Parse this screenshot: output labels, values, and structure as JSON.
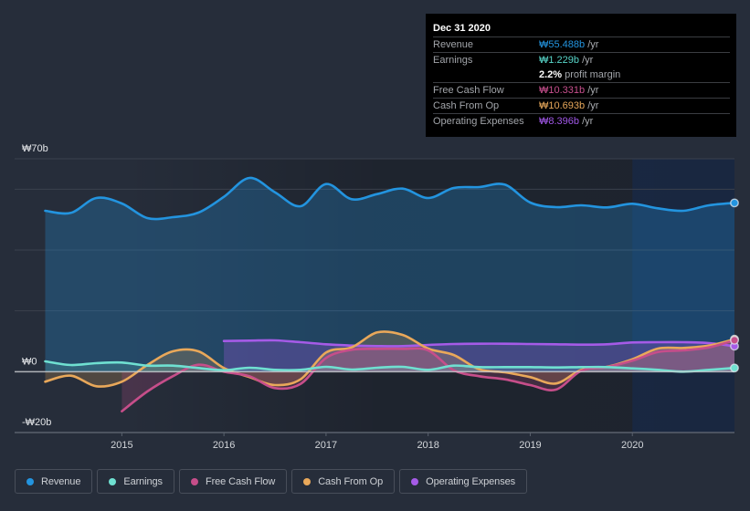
{
  "tooltip": {
    "date": "Dec 31 2020",
    "rows": [
      {
        "label": "Revenue",
        "value": "₩55.488b",
        "unit": " /yr",
        "color": "#2394df"
      },
      {
        "label": "Earnings",
        "value": "₩1.229b",
        "unit": " /yr",
        "color": "#58d5c9"
      },
      {
        "label": "Free Cash Flow",
        "value": "₩10.331b",
        "unit": " /yr",
        "color": "#c9508f"
      },
      {
        "label": "Cash From Op",
        "value": "₩10.693b",
        "unit": " /yr",
        "color": "#e6a75a"
      },
      {
        "label": "Operating Expenses",
        "value": "₩8.396b",
        "unit": " /yr",
        "color": "#a158e8"
      }
    ],
    "profit_margin": {
      "value": "2.2%",
      "text": " profit margin"
    }
  },
  "legend": [
    {
      "label": "Revenue",
      "color": "#2394df",
      "icon": "dot-icon"
    },
    {
      "label": "Earnings",
      "color": "#6fe0d1",
      "icon": "dot-icon"
    },
    {
      "label": "Free Cash Flow",
      "color": "#c64e8a",
      "icon": "dot-icon"
    },
    {
      "label": "Cash From Op",
      "color": "#e9a85a",
      "icon": "dot-icon"
    },
    {
      "label": "Operating Expenses",
      "color": "#a55be7",
      "icon": "dot-icon"
    }
  ],
  "chart_data": {
    "type": "line",
    "title": "",
    "xlabel": "",
    "ylabel": "",
    "xlim": [
      2013.95,
      2021.0
    ],
    "ylim": [
      -20,
      70
    ],
    "grid": true,
    "gridlines": [
      70,
      60,
      40,
      20
    ],
    "zero_line": 0,
    "highlight_range": [
      2020.0,
      2021.0
    ],
    "legend_position": "bottom-left",
    "y_ticks": [
      {
        "value": 70,
        "label": "₩70b"
      },
      {
        "value": 0,
        "label": "₩0"
      },
      {
        "value": -20,
        "label": "-₩20b"
      }
    ],
    "x_ticks": [
      {
        "value": 2015,
        "label": "2015"
      },
      {
        "value": 2016,
        "label": "2016"
      },
      {
        "value": 2017,
        "label": "2017"
      },
      {
        "value": 2018,
        "label": "2018"
      },
      {
        "value": 2019,
        "label": "2019"
      },
      {
        "value": 2020,
        "label": "2020"
      }
    ],
    "x": [
      2014.25,
      2014.5,
      2014.75,
      2015.0,
      2015.25,
      2015.5,
      2015.75,
      2016.0,
      2016.25,
      2016.5,
      2016.75,
      2017.0,
      2017.25,
      2017.5,
      2017.75,
      2018.0,
      2018.25,
      2018.5,
      2018.75,
      2019.0,
      2019.25,
      2019.5,
      2019.75,
      2020.0,
      2020.25,
      2020.5,
      2020.75,
      2021.0
    ],
    "units": "₩ billions per year",
    "series": [
      {
        "key": "revenue",
        "name": "Revenue",
        "color": "#2394df",
        "fill_opacity": 0.28,
        "values": [
          52.9,
          52.2,
          57.1,
          55.3,
          50.5,
          50.8,
          52.3,
          57.5,
          63.7,
          59.0,
          54.4,
          61.7,
          56.7,
          58.4,
          60.2,
          57.1,
          60.4,
          60.7,
          61.5,
          55.6,
          54.1,
          54.7,
          54.0,
          55.2,
          53.7,
          52.9,
          54.7,
          55.488
        ]
      },
      {
        "key": "opex",
        "name": "Operating Expenses",
        "color": "#a55be7",
        "fill_opacity": 0.28,
        "values": [
          null,
          null,
          null,
          null,
          null,
          null,
          null,
          10.1,
          10.2,
          10.3,
          9.7,
          9.0,
          8.6,
          8.4,
          8.4,
          8.8,
          9.1,
          9.2,
          9.2,
          9.1,
          9.0,
          8.9,
          9.0,
          9.6,
          9.7,
          9.7,
          9.4,
          8.396
        ]
      },
      {
        "key": "cfo",
        "name": "Cash From Op",
        "color": "#e9a85a",
        "fill_opacity": 0.22,
        "values": [
          -3.3,
          -1.3,
          -4.8,
          -3.3,
          2.2,
          6.7,
          6.7,
          1.2,
          -1.8,
          -4.4,
          -2.5,
          6.3,
          8.0,
          12.9,
          12.1,
          7.6,
          5.5,
          0.8,
          -0.2,
          -1.8,
          -3.9,
          0.6,
          1.6,
          4.1,
          7.6,
          7.8,
          8.6,
          10.693
        ]
      },
      {
        "key": "fcf",
        "name": "Free Cash Flow",
        "color": "#c64e8a",
        "fill_opacity": 0.22,
        "values": [
          null,
          null,
          null,
          -13.0,
          -6.5,
          -1.5,
          2.3,
          0.0,
          -1.5,
          -5.4,
          -4.0,
          4.5,
          7.2,
          7.5,
          7.5,
          7.0,
          0.5,
          -1.5,
          -2.5,
          -4.4,
          -5.9,
          0.3,
          1.5,
          3.6,
          6.5,
          7.0,
          8.0,
          10.331
        ]
      },
      {
        "key": "earnings",
        "name": "Earnings",
        "color": "#6fe0d1",
        "fill_opacity": 0.18,
        "values": [
          3.4,
          2.2,
          2.8,
          3.0,
          2.0,
          2.0,
          1.2,
          0.5,
          1.3,
          0.6,
          0.6,
          1.6,
          0.7,
          1.3,
          1.6,
          0.6,
          2.0,
          1.5,
          1.5,
          1.5,
          1.4,
          1.5,
          1.5,
          1.1,
          0.6,
          0.0,
          0.6,
          1.229
        ]
      }
    ]
  }
}
